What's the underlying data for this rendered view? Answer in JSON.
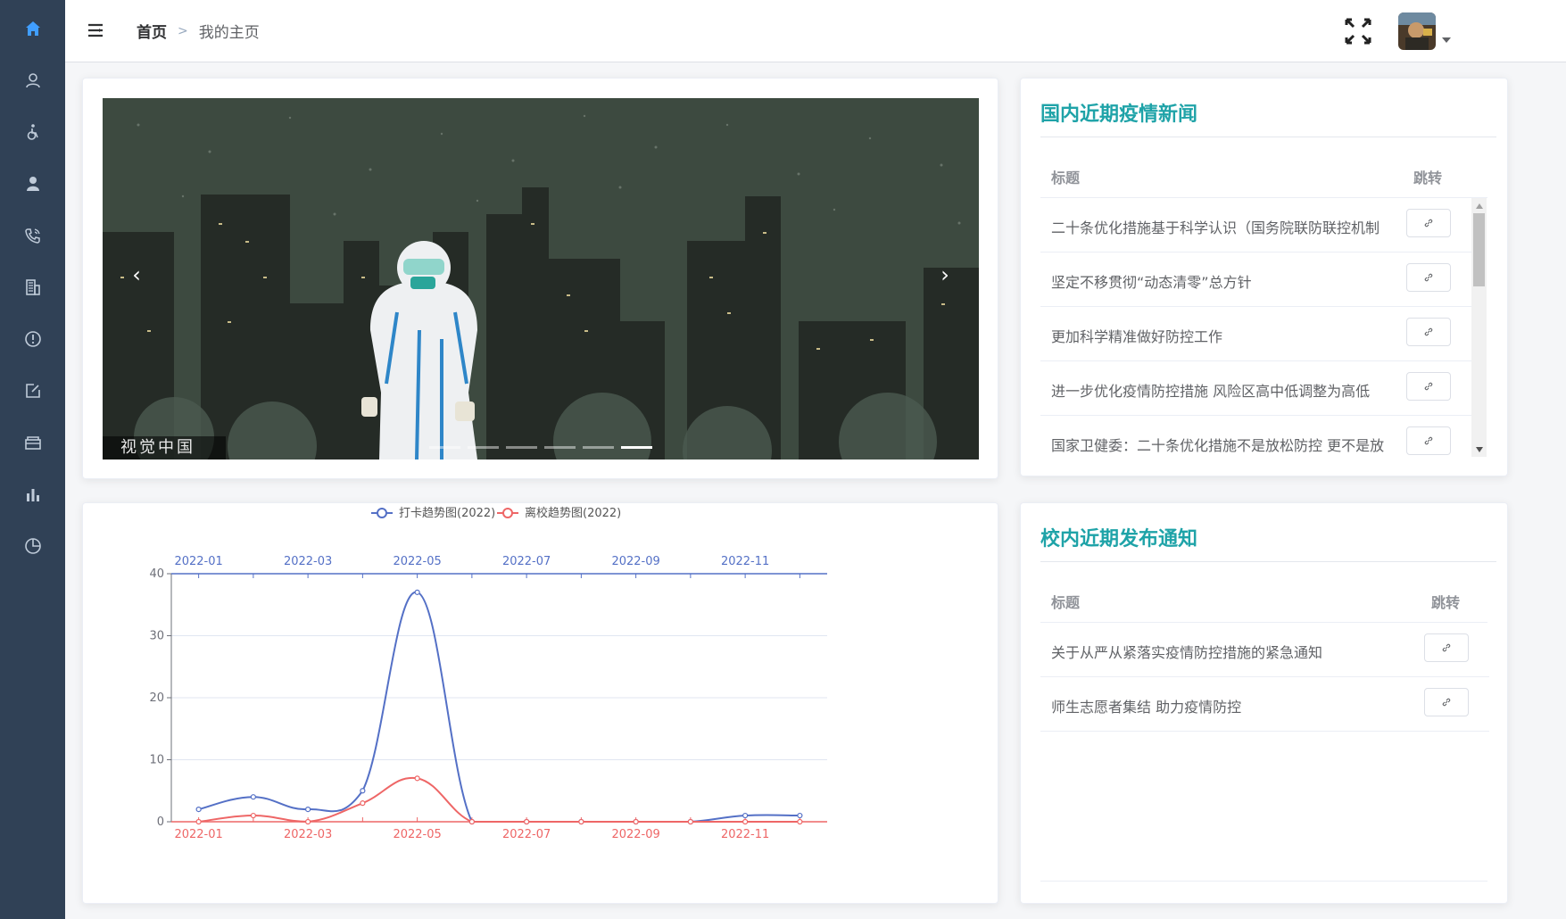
{
  "sidebar": {
    "items": [
      {
        "icon": "home-icon",
        "active": true
      },
      {
        "icon": "user-outline-icon"
      },
      {
        "icon": "wheelchair-icon"
      },
      {
        "icon": "user-icon"
      },
      {
        "icon": "phone-icon"
      },
      {
        "icon": "building-icon"
      },
      {
        "icon": "info-icon"
      },
      {
        "icon": "edit-icon"
      },
      {
        "icon": "box-icon"
      },
      {
        "icon": "bar-chart-icon"
      },
      {
        "icon": "pie-chart-icon"
      }
    ],
    "colors": {
      "bg": "#304156",
      "icon": "#bfcbd9",
      "active": "#409eff"
    }
  },
  "header": {
    "breadcrumb": {
      "home": "首页",
      "separator": ">",
      "current": "我的主页"
    }
  },
  "carousel": {
    "watermark": "视觉中国",
    "prev": "‹",
    "next": "›",
    "slide_count": 6,
    "active_index": 5
  },
  "news": {
    "title": "国内近期疫情新闻",
    "columns": {
      "title": "标题",
      "jump": "跳转"
    },
    "rows": [
      {
        "title": "二十条优化措施基于科学认识（国务院联防联控机制"
      },
      {
        "title": "坚定不移贯彻“动态清零”总方针"
      },
      {
        "title": "更加科学精准做好防控工作"
      },
      {
        "title": "进一步优化疫情防控措施 风险区高中低调整为高低"
      },
      {
        "title": "国家卫健委：二十条优化措施不是放松防控 更不是放"
      }
    ]
  },
  "notice": {
    "title": "校内近期发布通知",
    "columns": {
      "title": "标题",
      "jump": "跳转"
    },
    "rows": [
      {
        "title": "关于从严从紧落实疫情防控措施的紧急通知"
      },
      {
        "title": "师生志愿者集结 助力疫情防控"
      }
    ]
  },
  "chart_data": {
    "type": "line",
    "legend": [
      "打卡趋势图(2022)",
      "离校趋势图(2022)"
    ],
    "legend_placement": "top-center",
    "x": [
      "2022-01",
      "2022-02",
      "2022-03",
      "2022-04",
      "2022-05",
      "2022-06",
      "2022-07",
      "2022-08",
      "2022-09",
      "2022-10",
      "2022-11",
      "2022-12"
    ],
    "x_tick_labels": [
      "2022-01",
      "2022-03",
      "2022-05",
      "2022-07",
      "2022-09",
      "2022-11"
    ],
    "series": [
      {
        "name": "打卡趋势图(2022)",
        "color": "#5470c6",
        "axis": "top",
        "values": [
          2,
          4,
          2,
          5,
          37,
          0,
          0,
          0,
          0,
          0,
          1,
          1
        ]
      },
      {
        "name": "离校趋势图(2022)",
        "color": "#ee6666",
        "axis": "bottom",
        "values": [
          0,
          1,
          0,
          3,
          7,
          0,
          0,
          0,
          0,
          0,
          0,
          0
        ]
      }
    ],
    "yticks": [
      0,
      10,
      20,
      30,
      40
    ],
    "ylim": [
      0,
      40
    ],
    "grid": true,
    "smooth": true
  }
}
